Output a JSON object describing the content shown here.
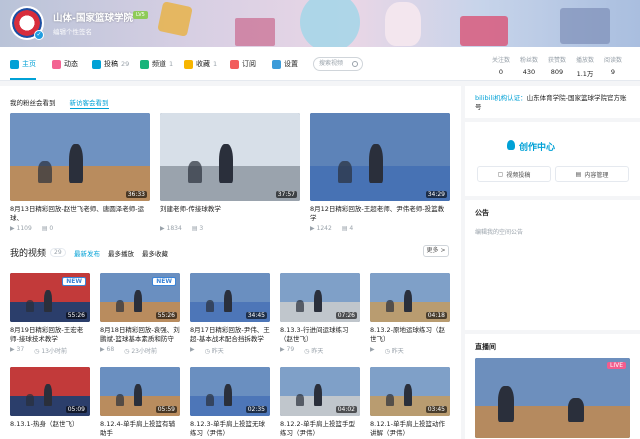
{
  "header": {
    "username": "山体-国家篮球学院",
    "level": "LV5",
    "signature": "编辑个性签名"
  },
  "nav": {
    "tabs": [
      {
        "label": "主页",
        "count": "",
        "color": "#00a1d6"
      },
      {
        "label": "动态",
        "count": "",
        "color": "#f36392"
      },
      {
        "label": "投稿",
        "count": "29",
        "color": "#00a1d6"
      },
      {
        "label": "频道",
        "count": "1",
        "color": "#18b47a"
      },
      {
        "label": "收藏",
        "count": "1",
        "color": "#f7b500"
      },
      {
        "label": "订阅",
        "count": "",
        "color": "#f25d5d"
      },
      {
        "label": "设置",
        "count": "",
        "color": "#3b9bd9"
      }
    ],
    "search_placeholder": "搜索视频",
    "stats": [
      {
        "label": "关注数",
        "value": "0"
      },
      {
        "label": "粉丝数",
        "value": "430"
      },
      {
        "label": "获赞数",
        "value": "809"
      },
      {
        "label": "播放数",
        "value": "1.1万"
      },
      {
        "label": "阅读数",
        "value": "9"
      }
    ]
  },
  "main": {
    "sub_tabs": [
      "我的粉丝会看到",
      "新访客会看到"
    ],
    "featured": [
      {
        "title": "8月13日精彩回放-赵世飞老师、唐圆泽老师-运球、",
        "duration": "36:33",
        "views": "1109",
        "comments": "0"
      },
      {
        "title": "刘建老师-传接球教学",
        "duration": "37:57",
        "views": "1834",
        "comments": "3"
      },
      {
        "title": "8月12日精彩回放-王超老师、尹伟老师-投篮教学",
        "duration": "34:29",
        "views": "1242",
        "comments": "4"
      }
    ],
    "my_videos": {
      "title": "我的视频",
      "count": "29",
      "sort_options": [
        "最新发布",
        "最多播放",
        "最多收藏"
      ],
      "more": "更多 >",
      "items": [
        {
          "title": "8月19日精彩回放-王宏老师-接球技术教学",
          "duration": "55:26",
          "views": "37",
          "time": "13小时前",
          "is_new": "NEW"
        },
        {
          "title": "8月18日精彩回放-袁强、刘鹏斌-篮球基本素质和防守脚步",
          "duration": "55:26",
          "views": "68",
          "time": "23小时前",
          "is_new": "NEW"
        },
        {
          "title": "8月17日精彩回放-尹伟、王超-基本战术配合挡拆教学",
          "duration": "34:45",
          "views": "",
          "time": "昨天",
          "is_new": ""
        },
        {
          "title": "8.13.3-行进间运球练习（赵世飞）",
          "duration": "07:26",
          "views": "79",
          "time": "昨天",
          "is_new": ""
        },
        {
          "title": "8.13.2-原地运球练习（赵世飞）",
          "duration": "04:18",
          "views": "",
          "time": "昨天",
          "is_new": ""
        },
        {
          "title": "8.13.1-热身（赵世飞）",
          "duration": "05:09",
          "views": "",
          "time": "",
          "is_new": ""
        },
        {
          "title": "8.12.4-单手肩上投篮有辅助手",
          "duration": "05:59",
          "views": "",
          "time": "",
          "is_new": ""
        },
        {
          "title": "8.12.3-单手肩上投篮无球练习（尹伟）",
          "duration": "02:35",
          "views": "",
          "time": "",
          "is_new": ""
        },
        {
          "title": "8.12.2-单手肩上投篮手型练习（尹伟）",
          "duration": "04:02",
          "views": "",
          "time": "",
          "is_new": ""
        },
        {
          "title": "8.12.1-单手肩上投篮动作讲解（尹伟）",
          "duration": "03:45",
          "views": "",
          "time": "",
          "is_new": ""
        }
      ]
    }
  },
  "sidebar": {
    "cert_prefix": "bilibili机构认证：",
    "cert_text": "山东体育学院-国家篮球学院官方账号",
    "create_center": "创作中心",
    "create_buttons": [
      "视频投稿",
      "内容管理"
    ],
    "announcement_title": "公告",
    "announcement_text": "编辑我的空间公告",
    "live_title": "直播间",
    "live_tag": "LIVE"
  }
}
